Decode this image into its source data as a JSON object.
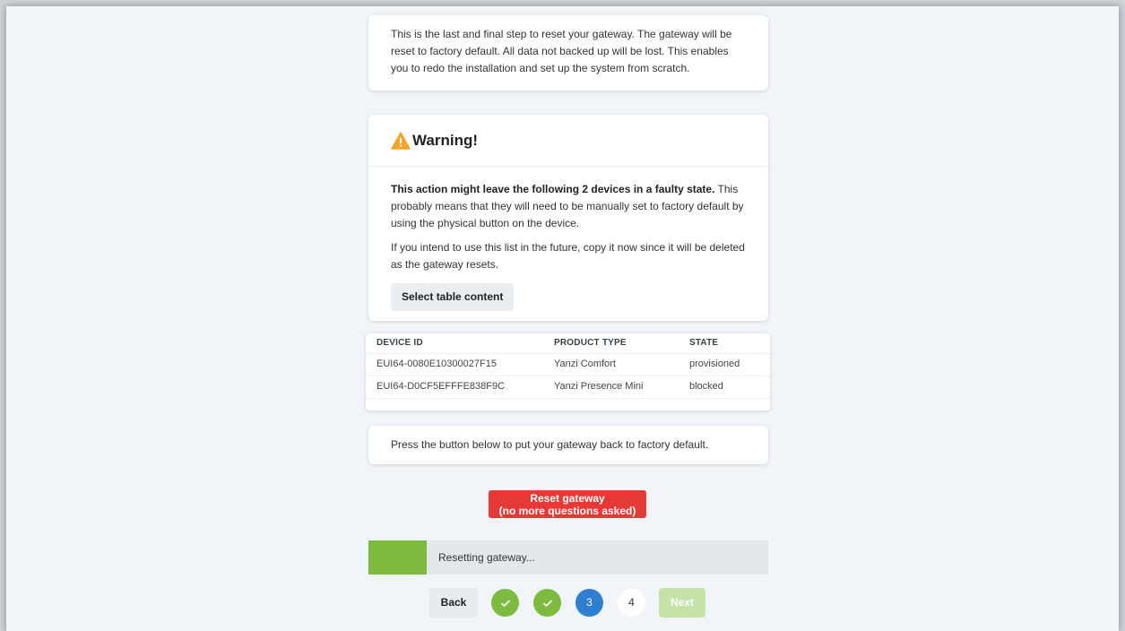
{
  "intro": {
    "text": "This is the last and final step to reset your gateway. The gateway will be reset to factory default. All data not backed up will be lost. This enables you to redo the installation and set up the system from scratch."
  },
  "warning": {
    "title": "Warning!",
    "bold_text": "This action might leave the following 2 devices in a faulty state.",
    "text1": " This probably means that they will need to be manually set to factory default by using the physical button on the device.",
    "text2": "If you intend to use this list in the future, copy it now since it will be deleted as the gateway resets.",
    "select_button": "Select table content"
  },
  "table": {
    "headers": [
      "DEVICE ID",
      "PRODUCT TYPE",
      "STATE"
    ],
    "rows": [
      [
        "EUI64-0080E10300027F15",
        "Yanzi Comfort",
        "provisioned"
      ],
      [
        "EUI64-D0CF5EFFFE838F9C",
        "Yanzi Presence Mini",
        "blocked"
      ]
    ]
  },
  "press_text": "Press the button below to put your gateway back to factory default.",
  "reset_button": {
    "line1": "Reset gateway",
    "line2": "(no more questions asked)"
  },
  "progress": {
    "text": "Resetting gateway...",
    "fraction": 0.145
  },
  "nav": {
    "back": "Back",
    "next": "Next",
    "steps": [
      "",
      "",
      "3",
      "4"
    ]
  },
  "colors": {
    "accent_green": "#7dbb3f",
    "accent_blue": "#2f7fd0",
    "danger_red": "#e53935",
    "warning_amber": "#f4a62a"
  }
}
